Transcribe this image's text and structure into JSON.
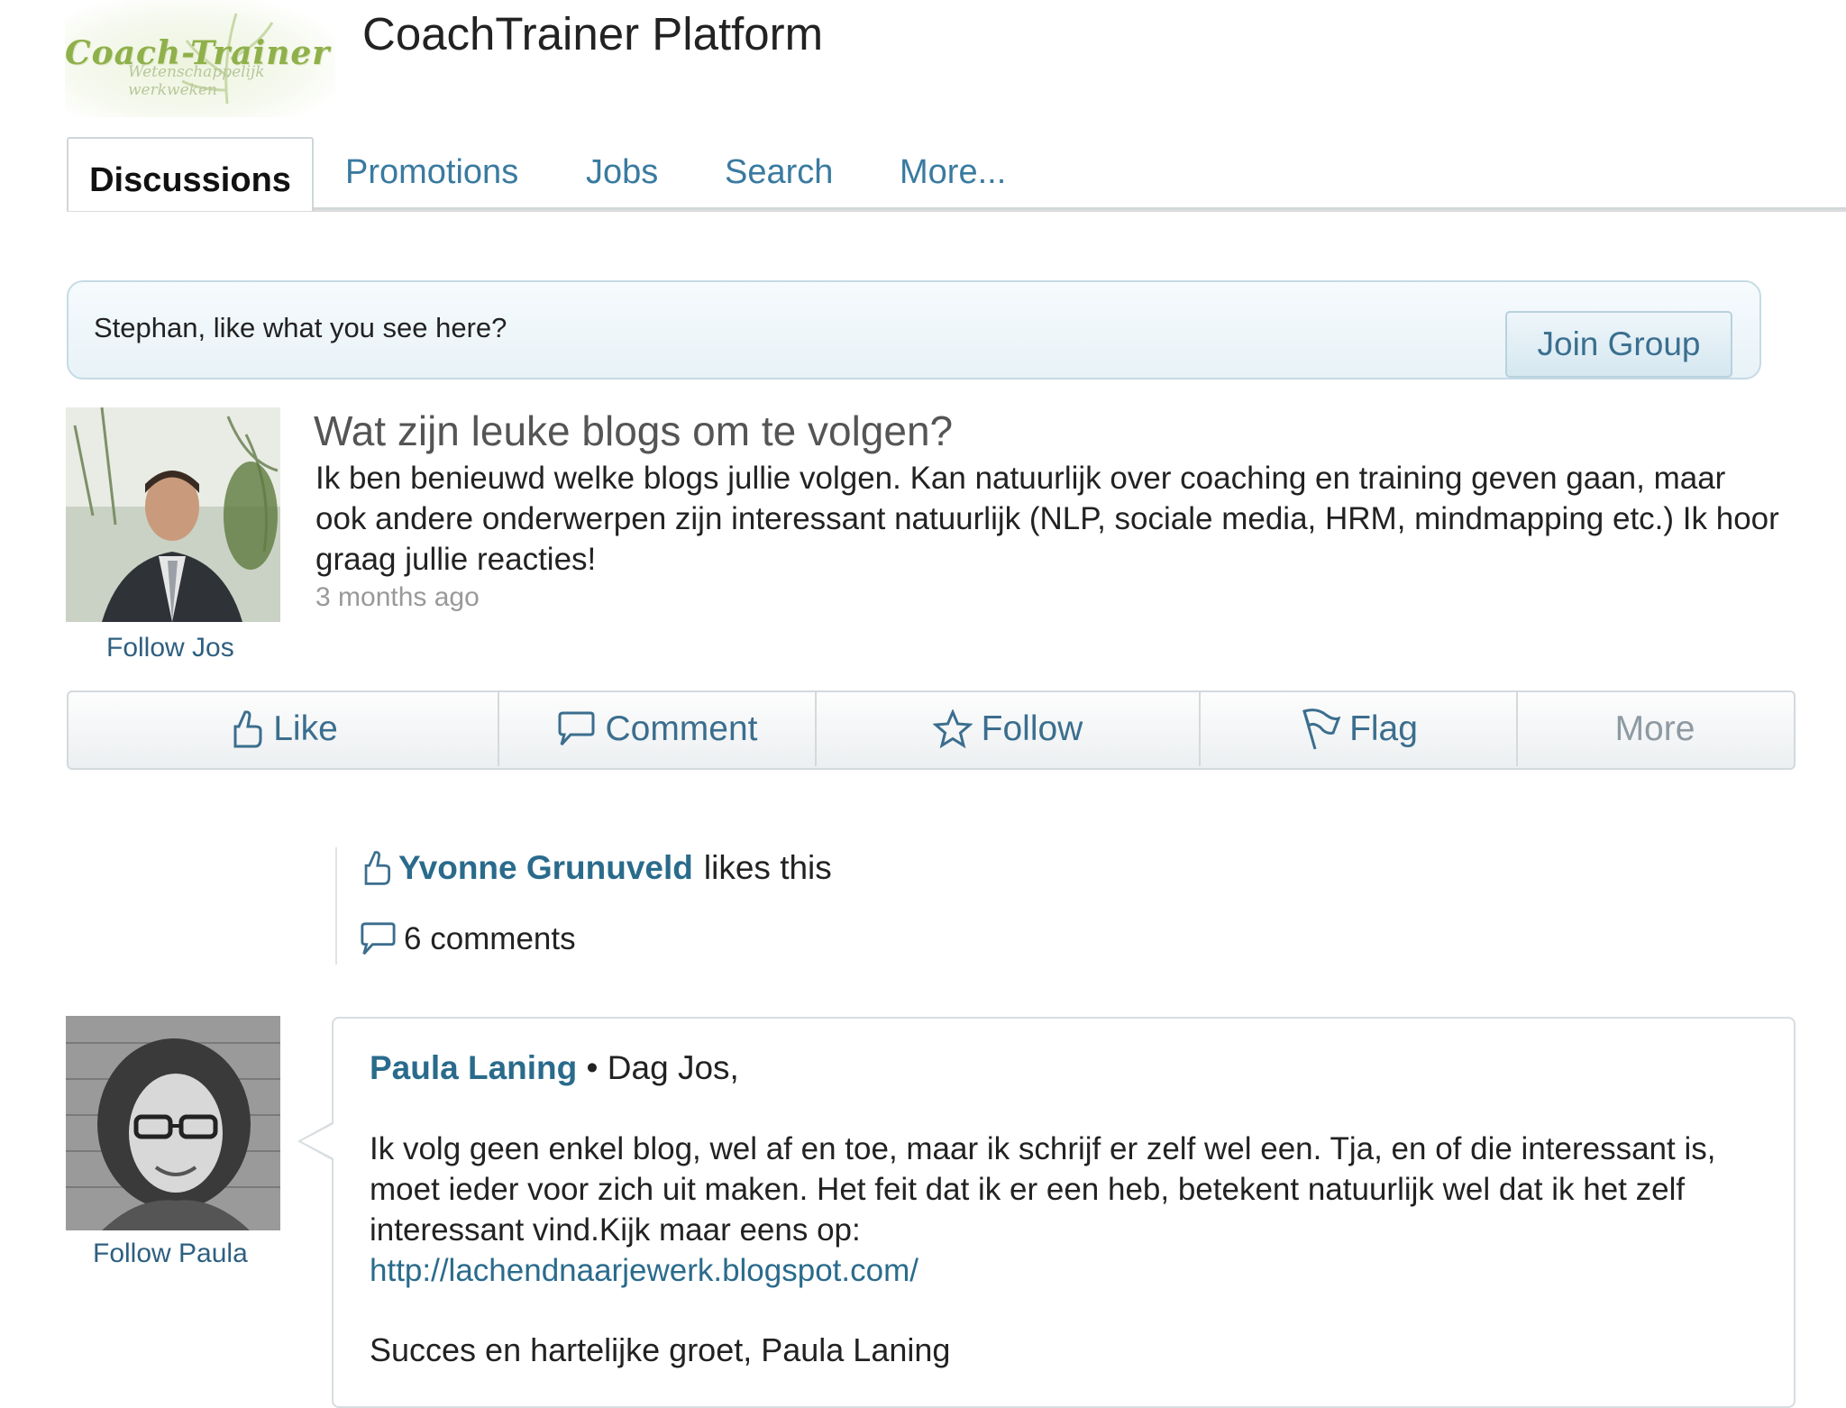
{
  "header": {
    "logo_text": "Coach-Trainer",
    "logo_sub": "Wetenschappelijk werkweken",
    "title": "CoachTrainer Platform"
  },
  "tabs": [
    {
      "label": "Discussions",
      "active": true
    },
    {
      "label": "Promotions"
    },
    {
      "label": "Jobs"
    },
    {
      "label": "Search"
    },
    {
      "label": "More..."
    }
  ],
  "banner": {
    "text": "Stephan, like what you see here?",
    "button": "Join Group"
  },
  "post": {
    "title": "Wat zijn leuke blogs om te volgen?",
    "body": "Ik ben benieuwd welke blogs jullie volgen. Kan natuurlijk over coaching en training geven gaan, maar ook andere onderwerpen zijn interessant natuurlijk (NLP, sociale media, HRM, mindmapping etc.) Ik hoor graag jullie reacties!",
    "time": "3 months ago",
    "follow_label": "Follow Jos"
  },
  "actions": {
    "like": "Like",
    "comment": "Comment",
    "follow": "Follow",
    "flag": "Flag",
    "more": "More"
  },
  "activity": {
    "liker_name": "Yvonne Grunuveld",
    "likes_suffix": "likes this",
    "comments_count": "6 comments"
  },
  "comment": {
    "author": "Paula Laning",
    "separator": "•",
    "greeting": "Dag Jos,",
    "body": "Ik volg geen enkel blog, wel af en toe, maar ik schrijf er zelf wel een. Tja, en of die interessant is, moet ieder voor zich uit maken. Het feit dat ik er een heb, betekent natuurlijk wel dat ik het zelf interessant vind.Kijk maar eens op:",
    "link": "http://lachendnaarjewerk.blogspot.com/",
    "signature": "Succes en hartelijke groet, Paula Laning",
    "follow_label": "Follow Paula"
  },
  "colors": {
    "link": "#2a6b8c",
    "banner_bg": "#e8f2f7",
    "logo_green": "#8fb04a"
  }
}
